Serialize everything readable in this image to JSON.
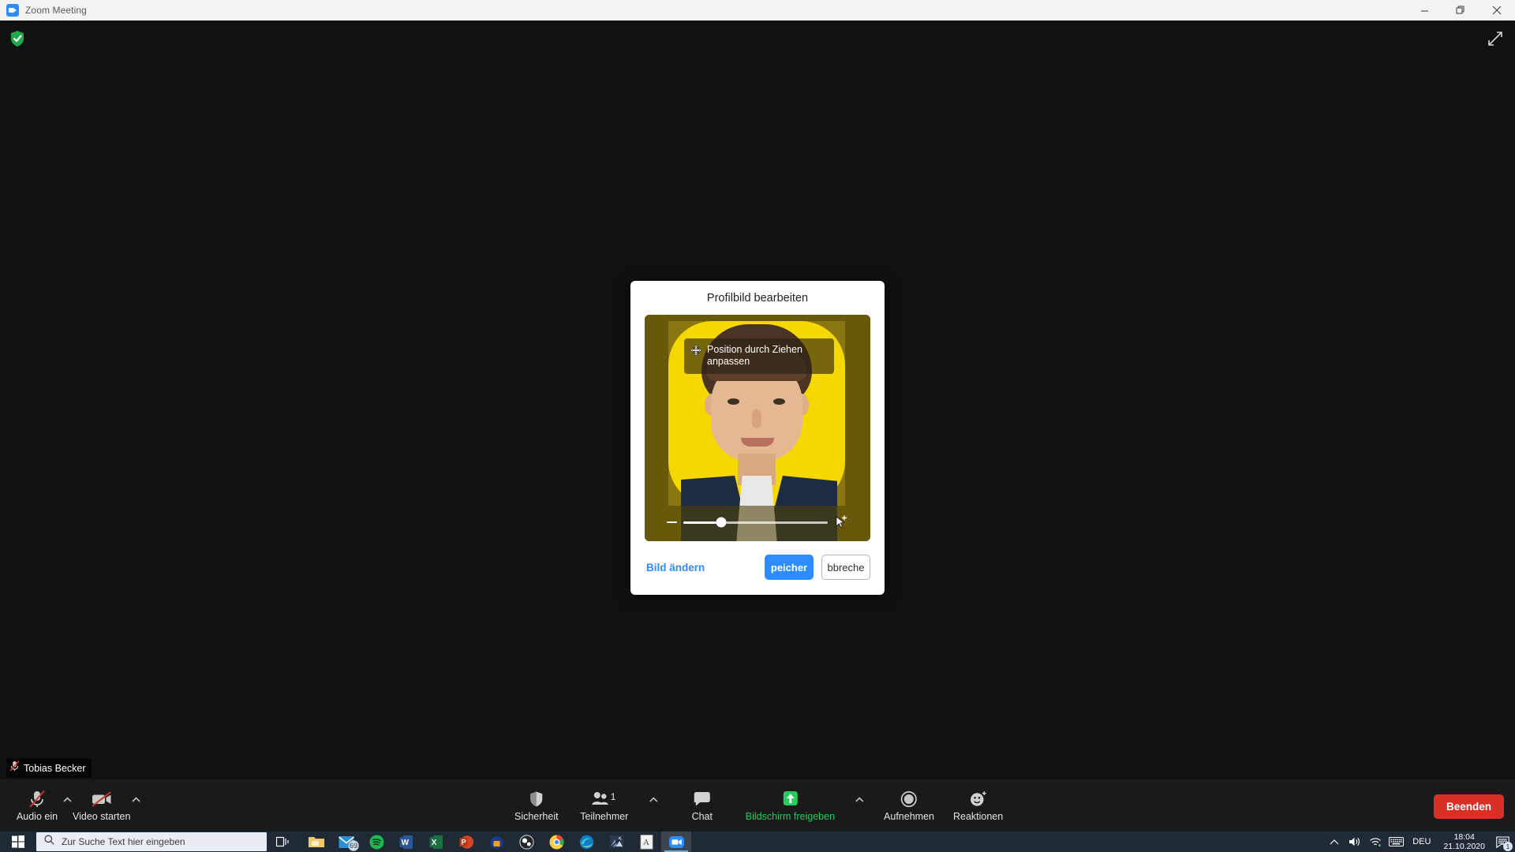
{
  "window": {
    "title": "Zoom Meeting",
    "app_icon": "zoom-camera-icon",
    "controls": {
      "minimize": "minimize-icon",
      "restore": "restore-icon",
      "close": "close-icon"
    }
  },
  "stage": {
    "encryption_icon": "green-shield-check-icon",
    "fullscreen_icon": "expand-diagonal-icon"
  },
  "dialog": {
    "title": "Profilbild bearbeiten",
    "drag_hint": "Position durch Ziehen anpassen",
    "drag_icon": "move-four-arrows-icon",
    "zoom_slider": {
      "minus_icon": "minus-icon",
      "plus_cursor_icon": "plus-cursor-icon",
      "value_percent": 26
    },
    "change_image_label": "Bild ändern",
    "save_label": "peicher",
    "cancel_label": "bbreche",
    "accent_color": "#2d8cff"
  },
  "meeting": {
    "nameplate": "Tobias Becker",
    "nameplate_icon": "mic-muted-icon",
    "left_tools": [
      {
        "label": "Audio ein",
        "icon": "mic-muted-icon",
        "has_caret": true
      },
      {
        "label": "Video starten",
        "icon": "video-off-icon",
        "has_caret": true
      }
    ],
    "center_tools": [
      {
        "label": "Sicherheit",
        "icon": "shield-icon",
        "has_caret": false,
        "count": ""
      },
      {
        "label": "Teilnehmer",
        "icon": "participants-icon",
        "has_caret": true,
        "count": "1"
      },
      {
        "label": "Chat",
        "icon": "chat-bubble-icon",
        "has_caret": false,
        "count": ""
      },
      {
        "label": "Bildschirm freigeben",
        "icon": "share-screen-up-arrow-icon",
        "has_caret": true,
        "count": ""
      },
      {
        "label": "Aufnehmen",
        "icon": "record-circle-icon",
        "has_caret": false,
        "count": ""
      },
      {
        "label": "Reaktionen",
        "icon": "reactions-smiley-icon",
        "has_caret": false,
        "count": ""
      }
    ],
    "share_color": "#27cc5f",
    "end_button_label": "Beenden",
    "end_button_color": "#d93025"
  },
  "taskbar": {
    "start_icon": "windows-start-icon",
    "search_placeholder": "Zur Suche Text hier eingeben",
    "search_icon": "search-icon",
    "taskview_icon": "task-view-icon",
    "apps": [
      {
        "name": "file-explorer",
        "badge": ""
      },
      {
        "name": "mail",
        "badge": "69"
      },
      {
        "name": "spotify",
        "badge": ""
      },
      {
        "name": "word",
        "badge": ""
      },
      {
        "name": "excel",
        "badge": ""
      },
      {
        "name": "powerpoint",
        "badge": ""
      },
      {
        "name": "audacity",
        "badge": ""
      },
      {
        "name": "obs-studio",
        "badge": ""
      },
      {
        "name": "google-chrome",
        "badge": ""
      },
      {
        "name": "microsoft-edge",
        "badge": ""
      },
      {
        "name": "photos",
        "badge": ""
      },
      {
        "name": "acrobat-reader",
        "badge": ""
      },
      {
        "name": "zoom",
        "badge": ""
      }
    ],
    "tray": {
      "chevron_icon": "show-hidden-icons-icon",
      "volume_icon": "speaker-icon",
      "network_icon": "wifi-icon",
      "keyboard_icon": "touch-keyboard-icon",
      "language": "DEU",
      "time": "18:04",
      "date": "21.10.2020",
      "notification_icon": "action-center-icon",
      "notification_count": "1"
    }
  }
}
